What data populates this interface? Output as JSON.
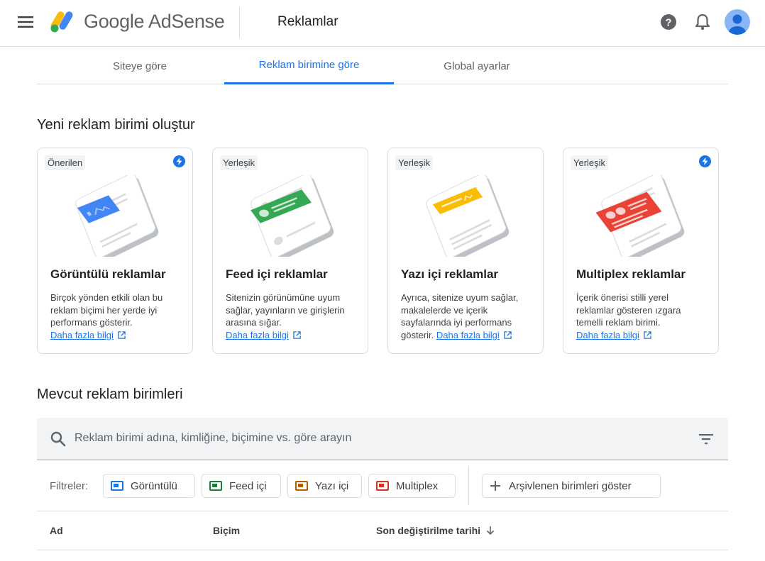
{
  "header": {
    "logo_google": "Google",
    "logo_product": "AdSense",
    "page_title": "Reklamlar"
  },
  "tabs": [
    {
      "label": "Siteye göre",
      "active": false
    },
    {
      "label": "Reklam birimine göre",
      "active": true
    },
    {
      "label": "Global ayarlar",
      "active": false
    }
  ],
  "create_section": {
    "title": "Yeni reklam birimi oluştur",
    "cards": [
      {
        "chip": "Önerilen",
        "has_bolt": true,
        "title": "Görüntülü reklamlar",
        "description": "Birçok yönden etkili olan bu reklam biçimi her yerde iyi performans gösterir.",
        "link": "Daha fazla bilgi",
        "accent": "#4285f4"
      },
      {
        "chip": "Yerleşik",
        "has_bolt": false,
        "title": "Feed içi reklamlar",
        "description": "Sitenizin görünümüne uyum sağlar, yayınların ve girişlerin arasına sığar.",
        "link": "Daha fazla bilgi",
        "accent": "#34a853"
      },
      {
        "chip": "Yerleşik",
        "has_bolt": false,
        "title": "Yazı içi reklamlar",
        "description": "Ayrıca, sitenize uyum sağlar, makalelerde ve içerik sayfalarında iyi performans gösterir.",
        "link": "Daha fazla bilgi",
        "accent": "#fbbc04"
      },
      {
        "chip": "Yerleşik",
        "has_bolt": true,
        "title": "Multiplex reklamlar",
        "description": "İçerik önerisi stilli yerel reklamlar gösteren ızgara temelli reklam birimi.",
        "link": "Daha fazla bilgi",
        "accent": "#ea4335"
      }
    ]
  },
  "existing_section": {
    "title": "Mevcut reklam birimleri",
    "search_placeholder": "Reklam birimi adına, kimliğine, biçimine vs. göre arayın",
    "filters_label": "Filtreler:",
    "filter_chips": [
      {
        "label": "Görüntülü",
        "color": "#1a73e8"
      },
      {
        "label": "Feed içi",
        "color": "#188038"
      },
      {
        "label": "Yazı içi",
        "color": "#b06000"
      },
      {
        "label": "Multiplex",
        "color": "#d93025"
      }
    ],
    "archive_button": "Arşivlenen birimleri göster",
    "columns": [
      "Ad",
      "Biçim",
      "Son değiştirilme tarihi"
    ]
  }
}
